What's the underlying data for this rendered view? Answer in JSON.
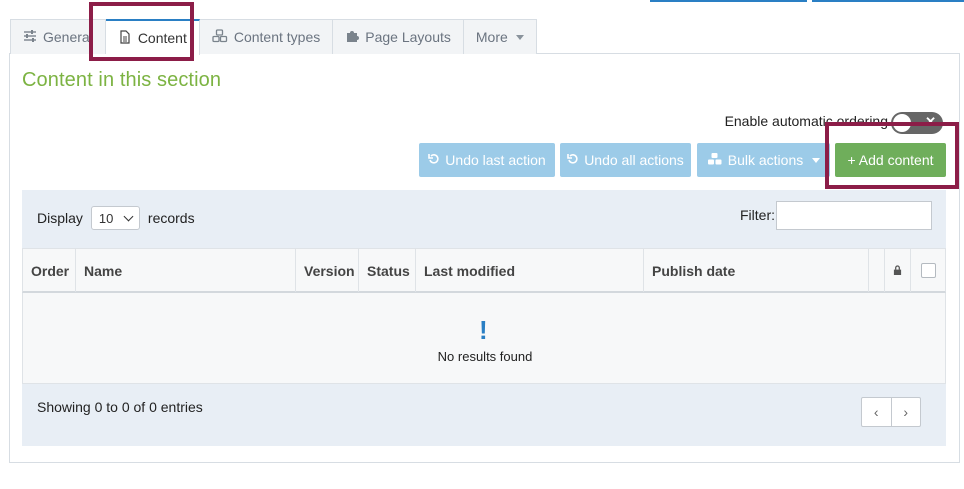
{
  "tabs": [
    {
      "label": "General",
      "icon": "sliders-icon"
    },
    {
      "label": "Content",
      "icon": "document-icon"
    },
    {
      "label": "Content types",
      "icon": "cubes-icon"
    },
    {
      "label": "Page Layouts",
      "icon": "puzzle-icon"
    },
    {
      "label": "More",
      "icon": "caret-down-icon"
    }
  ],
  "section_title": "Content in this section",
  "ordering": {
    "label": "Enable automatic ordering",
    "enabled": false
  },
  "toolbar": {
    "undo_last": "Undo last action",
    "undo_all": "Undo all actions",
    "bulk_actions": "Bulk actions",
    "add_content": "+ Add content"
  },
  "table_controls": {
    "display_label": "Display",
    "page_size": "10",
    "records_label": "records",
    "filter_label": "Filter:",
    "filter_value": ""
  },
  "columns": [
    "Order",
    "Name",
    "Version",
    "Status",
    "Last modified",
    "Publish date"
  ],
  "empty": {
    "mark": "!",
    "message": "No results found"
  },
  "footer": {
    "showing": "Showing 0 to 0 of 0 entries",
    "prev": "‹",
    "next": "›"
  },
  "colors": {
    "accent": "#2a7fc4",
    "success": "#6fae5b",
    "title": "#7cb342",
    "highlight": "#8c1d48"
  }
}
